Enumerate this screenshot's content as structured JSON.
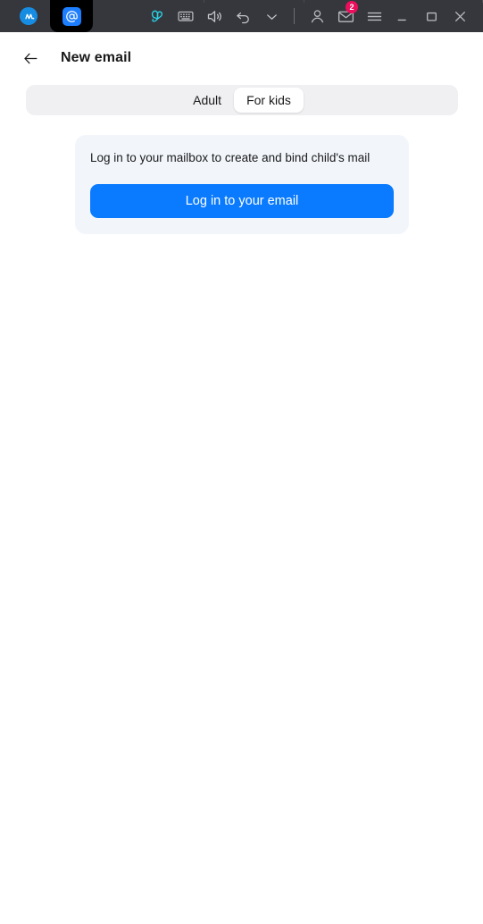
{
  "titlebar": {
    "background": "#35373D",
    "tabs": [
      {
        "name": "mailru-app",
        "label": "M",
        "active": false
      },
      {
        "name": "email-app",
        "label": "@",
        "active": true
      }
    ],
    "tools": [
      {
        "name": "butterfly-icon",
        "label": "butterfly-icon",
        "color": "#2ad4e8"
      },
      {
        "name": "keyboard-icon",
        "label": "keyboard-icon"
      },
      {
        "name": "volume-icon",
        "label": "volume-icon"
      },
      {
        "name": "undo-icon",
        "label": "undo-icon"
      },
      {
        "name": "chevron-down-icon",
        "label": "chevron-down-icon"
      },
      {
        "name": "account-icon",
        "label": "account-icon"
      },
      {
        "name": "mail-icon",
        "label": "mail-icon",
        "badge": "2",
        "badge_color": "#EC0E5C"
      },
      {
        "name": "menu-icon",
        "label": "menu-icon"
      },
      {
        "name": "minimize-icon",
        "label": "minimize-icon"
      },
      {
        "name": "maximize-icon",
        "label": "maximize-icon"
      },
      {
        "name": "close-icon",
        "label": "close-icon"
      }
    ]
  },
  "header": {
    "back_label": "back-arrow-icon",
    "title": "New email"
  },
  "segmented_control": {
    "options": [
      {
        "label": "Adult",
        "active": false
      },
      {
        "label": "For kids",
        "active": true
      }
    ],
    "background": "#F0F0F3",
    "active_background": "#FFFFFF"
  },
  "card": {
    "background": "#F2F6FB",
    "message": "Log in to your mailbox to create and bind child's mail",
    "button_label": "Log in to your email",
    "button_color": "#0A7BFF"
  }
}
